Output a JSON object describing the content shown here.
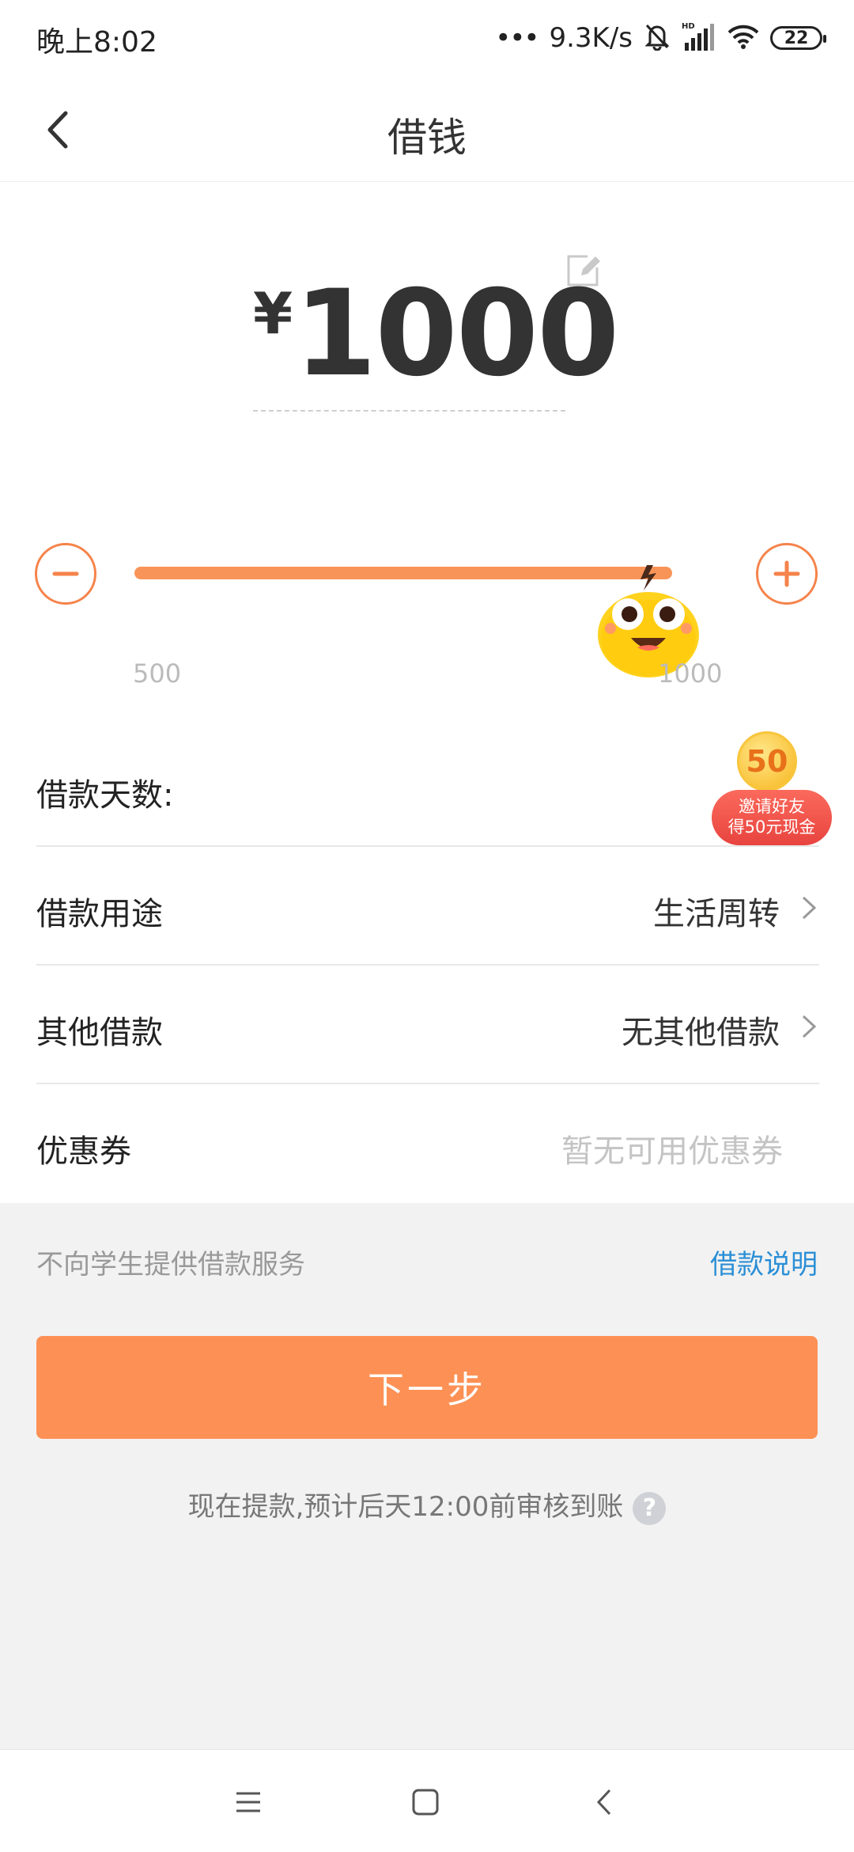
{
  "status_bar": {
    "time": "晚上8:02",
    "dots": "•••",
    "net_speed": "9.3K/s",
    "battery": "22"
  },
  "nav": {
    "title": "借钱"
  },
  "amount": {
    "currency": "¥",
    "value": "1000"
  },
  "slider": {
    "min_label": "500",
    "max_label": "1000",
    "min": 500,
    "max": 1000,
    "value": 1000
  },
  "rows": {
    "days_label": "借款天数:",
    "purpose_label": "借款用途",
    "purpose_value": "生活周转",
    "other_label": "其他借款",
    "other_value": "无其他借款",
    "coupon_label": "优惠券",
    "coupon_value": "暂无可用优惠券"
  },
  "invite": {
    "amount": "50",
    "line1": "邀请好友",
    "line2": "得50元现金"
  },
  "footer": {
    "notice": "不向学生提供借款服务",
    "explain_link": "借款说明",
    "next_button": "下一步",
    "eta": "现在提款,预计后天12:00前审核到账",
    "help": "?"
  },
  "colors": {
    "accent": "#fd9155",
    "link": "#2b8fd6"
  }
}
